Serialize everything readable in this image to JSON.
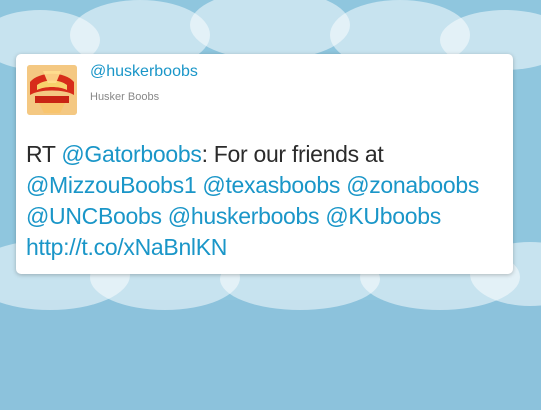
{
  "tweet": {
    "handle": "@huskerboobs",
    "display_name": "Husker Boobs",
    "avatar_icon": "nebraska-logo-avatar",
    "text": {
      "prefix": "RT ",
      "mention_source": "@Gatorboobs",
      "after_source": ": For our friends at",
      "mentions": [
        "@MizzouBoobs1",
        "@texasboobs",
        "@zonaboobs",
        "@UNCBoobs",
        "@huskerboobs",
        "@KUboobs"
      ],
      "url": "http://t.co/xNaBnlKN"
    }
  },
  "colors": {
    "link": "#1a96c8",
    "sky": "#8fc6de",
    "text": "#2b2b2b"
  }
}
